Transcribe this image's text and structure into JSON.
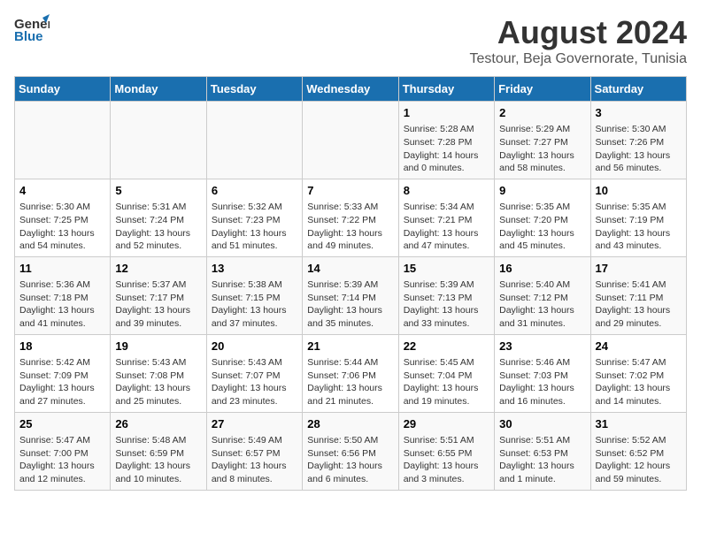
{
  "logo": {
    "general": "General",
    "blue": "Blue"
  },
  "title": "August 2024",
  "subtitle": "Testour, Beja Governorate, Tunisia",
  "days_of_week": [
    "Sunday",
    "Monday",
    "Tuesday",
    "Wednesday",
    "Thursday",
    "Friday",
    "Saturday"
  ],
  "weeks": [
    [
      {
        "day": "",
        "content": ""
      },
      {
        "day": "",
        "content": ""
      },
      {
        "day": "",
        "content": ""
      },
      {
        "day": "",
        "content": ""
      },
      {
        "day": "1",
        "content": "Sunrise: 5:28 AM\nSunset: 7:28 PM\nDaylight: 14 hours\nand 0 minutes."
      },
      {
        "day": "2",
        "content": "Sunrise: 5:29 AM\nSunset: 7:27 PM\nDaylight: 13 hours\nand 58 minutes."
      },
      {
        "day": "3",
        "content": "Sunrise: 5:30 AM\nSunset: 7:26 PM\nDaylight: 13 hours\nand 56 minutes."
      }
    ],
    [
      {
        "day": "4",
        "content": "Sunrise: 5:30 AM\nSunset: 7:25 PM\nDaylight: 13 hours\nand 54 minutes."
      },
      {
        "day": "5",
        "content": "Sunrise: 5:31 AM\nSunset: 7:24 PM\nDaylight: 13 hours\nand 52 minutes."
      },
      {
        "day": "6",
        "content": "Sunrise: 5:32 AM\nSunset: 7:23 PM\nDaylight: 13 hours\nand 51 minutes."
      },
      {
        "day": "7",
        "content": "Sunrise: 5:33 AM\nSunset: 7:22 PM\nDaylight: 13 hours\nand 49 minutes."
      },
      {
        "day": "8",
        "content": "Sunrise: 5:34 AM\nSunset: 7:21 PM\nDaylight: 13 hours\nand 47 minutes."
      },
      {
        "day": "9",
        "content": "Sunrise: 5:35 AM\nSunset: 7:20 PM\nDaylight: 13 hours\nand 45 minutes."
      },
      {
        "day": "10",
        "content": "Sunrise: 5:35 AM\nSunset: 7:19 PM\nDaylight: 13 hours\nand 43 minutes."
      }
    ],
    [
      {
        "day": "11",
        "content": "Sunrise: 5:36 AM\nSunset: 7:18 PM\nDaylight: 13 hours\nand 41 minutes."
      },
      {
        "day": "12",
        "content": "Sunrise: 5:37 AM\nSunset: 7:17 PM\nDaylight: 13 hours\nand 39 minutes."
      },
      {
        "day": "13",
        "content": "Sunrise: 5:38 AM\nSunset: 7:15 PM\nDaylight: 13 hours\nand 37 minutes."
      },
      {
        "day": "14",
        "content": "Sunrise: 5:39 AM\nSunset: 7:14 PM\nDaylight: 13 hours\nand 35 minutes."
      },
      {
        "day": "15",
        "content": "Sunrise: 5:39 AM\nSunset: 7:13 PM\nDaylight: 13 hours\nand 33 minutes."
      },
      {
        "day": "16",
        "content": "Sunrise: 5:40 AM\nSunset: 7:12 PM\nDaylight: 13 hours\nand 31 minutes."
      },
      {
        "day": "17",
        "content": "Sunrise: 5:41 AM\nSunset: 7:11 PM\nDaylight: 13 hours\nand 29 minutes."
      }
    ],
    [
      {
        "day": "18",
        "content": "Sunrise: 5:42 AM\nSunset: 7:09 PM\nDaylight: 13 hours\nand 27 minutes."
      },
      {
        "day": "19",
        "content": "Sunrise: 5:43 AM\nSunset: 7:08 PM\nDaylight: 13 hours\nand 25 minutes."
      },
      {
        "day": "20",
        "content": "Sunrise: 5:43 AM\nSunset: 7:07 PM\nDaylight: 13 hours\nand 23 minutes."
      },
      {
        "day": "21",
        "content": "Sunrise: 5:44 AM\nSunset: 7:06 PM\nDaylight: 13 hours\nand 21 minutes."
      },
      {
        "day": "22",
        "content": "Sunrise: 5:45 AM\nSunset: 7:04 PM\nDaylight: 13 hours\nand 19 minutes."
      },
      {
        "day": "23",
        "content": "Sunrise: 5:46 AM\nSunset: 7:03 PM\nDaylight: 13 hours\nand 16 minutes."
      },
      {
        "day": "24",
        "content": "Sunrise: 5:47 AM\nSunset: 7:02 PM\nDaylight: 13 hours\nand 14 minutes."
      }
    ],
    [
      {
        "day": "25",
        "content": "Sunrise: 5:47 AM\nSunset: 7:00 PM\nDaylight: 13 hours\nand 12 minutes."
      },
      {
        "day": "26",
        "content": "Sunrise: 5:48 AM\nSunset: 6:59 PM\nDaylight: 13 hours\nand 10 minutes."
      },
      {
        "day": "27",
        "content": "Sunrise: 5:49 AM\nSunset: 6:57 PM\nDaylight: 13 hours\nand 8 minutes."
      },
      {
        "day": "28",
        "content": "Sunrise: 5:50 AM\nSunset: 6:56 PM\nDaylight: 13 hours\nand 6 minutes."
      },
      {
        "day": "29",
        "content": "Sunrise: 5:51 AM\nSunset: 6:55 PM\nDaylight: 13 hours\nand 3 minutes."
      },
      {
        "day": "30",
        "content": "Sunrise: 5:51 AM\nSunset: 6:53 PM\nDaylight: 13 hours\nand 1 minute."
      },
      {
        "day": "31",
        "content": "Sunrise: 5:52 AM\nSunset: 6:52 PM\nDaylight: 12 hours\nand 59 minutes."
      }
    ]
  ]
}
